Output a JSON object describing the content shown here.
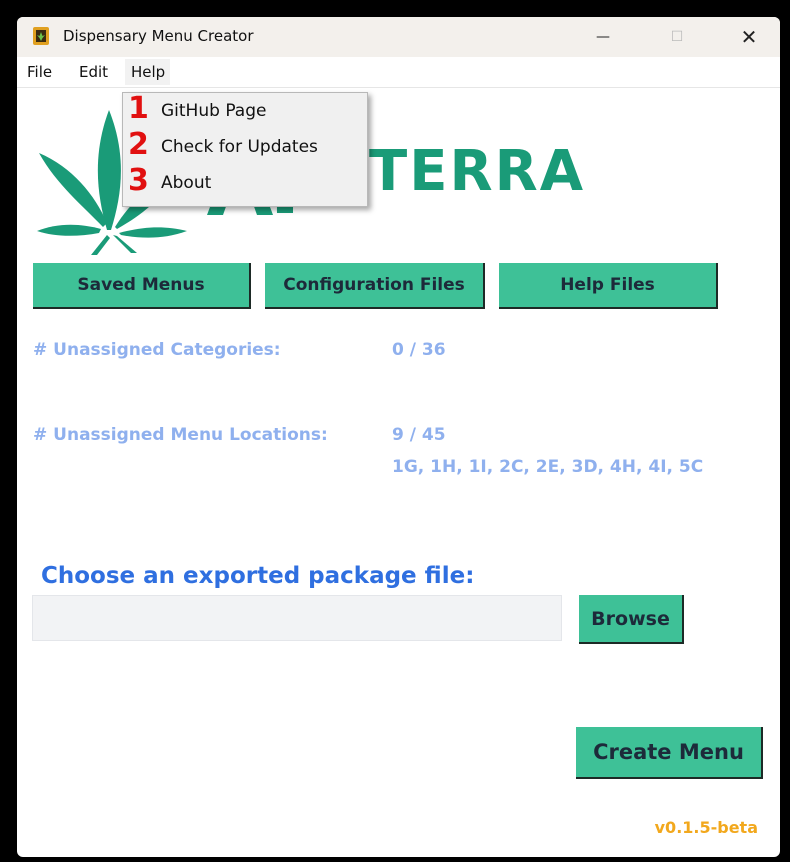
{
  "window": {
    "title": "Dispensary Menu Creator",
    "controls": {
      "minimize": "—",
      "maximize": "☐",
      "close": "✕"
    }
  },
  "menubar": {
    "items": [
      "File",
      "Edit",
      "Help"
    ]
  },
  "help_menu": {
    "items": [
      {
        "num": "1",
        "label": "GitHub Page"
      },
      {
        "num": "2",
        "label": "Check for Updates"
      },
      {
        "num": "3",
        "label": "About"
      }
    ]
  },
  "brand": {
    "text": "TERRA",
    "color": "#1a9b78"
  },
  "buttons": {
    "saved_menus": "Saved Menus",
    "config_files": "Configuration Files",
    "help_files": "Help Files",
    "browse": "Browse",
    "create_menu": "Create Menu"
  },
  "stats": {
    "categories_label": "# Unassigned Categories:",
    "categories_value": "0 / 36",
    "locations_label": "# Unassigned Menu Locations:",
    "locations_value": "9 / 45",
    "locations_list": "1G,  1H,  1I,  2C,  2E,  3D,  4H,  4I,  5C"
  },
  "file_picker": {
    "label": "Choose an exported package file:",
    "value": ""
  },
  "version": "v0.1.5-beta",
  "colors": {
    "accent": "#3ec197",
    "link_blue": "#2f6fe0",
    "stat_blue": "#8fb0ee",
    "version": "#f2a81d",
    "marker_red": "#e11010"
  }
}
